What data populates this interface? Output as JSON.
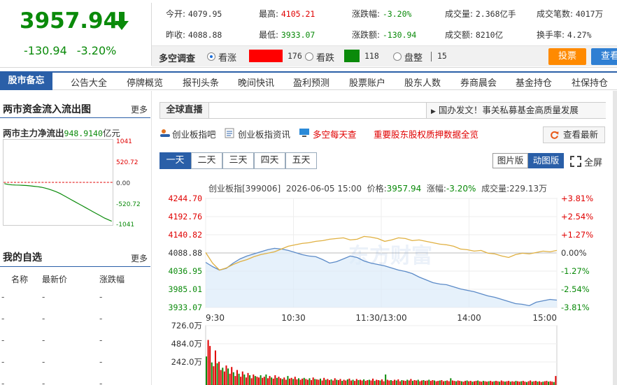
{
  "quote": {
    "price": "3957.94",
    "change": "-130.94",
    "change_pct": "-3.20%",
    "fields": [
      {
        "label": "今开:",
        "value": "4079.95"
      },
      {
        "label": "最高:",
        "value": "4105.21"
      },
      {
        "label": "涨跌幅:",
        "value": "-3.20%"
      },
      {
        "label": "成交量:",
        "value": "2.368亿手"
      },
      {
        "label": "成交笔数:",
        "value": "4017万"
      },
      {
        "label": "昨收:",
        "value": "4088.88"
      },
      {
        "label": "最低:",
        "value": "3933.07"
      },
      {
        "label": "涨跌额:",
        "value": "-130.94"
      },
      {
        "label": "成交额:",
        "value": "8210亿"
      },
      {
        "label": "换手率:",
        "value": "4.27%"
      }
    ]
  },
  "survey": {
    "title": "多空调查",
    "bull_label": "看涨",
    "bull_count": "176",
    "bear_label": "看跌",
    "bear_count": "118",
    "flat_label": "盘整",
    "flat_count": "15",
    "vote_label": "投票",
    "view_label": "查看"
  },
  "nav": {
    "title": "股市备忘",
    "items": [
      "公告大全",
      "停牌概览",
      "报刊头条",
      "晚间快讯",
      "盈利预测",
      "股票账户",
      "股东人数",
      "券商晨会",
      "基金持仓",
      "社保持仓"
    ]
  },
  "flow": {
    "title": "两市资金流入流出图",
    "more": "更多",
    "net_label": "两市主力净流出",
    "net_value": "948.9140",
    "net_unit": "亿元",
    "axis_labels": [
      "1041",
      "520.72",
      "0.00",
      "-520.72",
      "-1041"
    ],
    "chart_data": {
      "type": "line",
      "ylim": [
        -1041,
        1041
      ],
      "values": [
        -30,
        -50,
        -60,
        -65,
        -68,
        -72,
        -78,
        -85,
        -95,
        -105,
        -120,
        -140,
        -165,
        -195,
        -230,
        -270,
        -320,
        -370,
        -420,
        -470,
        -520,
        -570,
        -620,
        -670,
        -720,
        -770,
        -820,
        -870,
        -910,
        -949
      ]
    }
  },
  "watchlist": {
    "title": "我的自选",
    "more": "更多",
    "columns": [
      "名称",
      "最新价",
      "涨跌幅"
    ],
    "rows": [
      [
        "-",
        "-",
        "-"
      ],
      [
        "-",
        "-",
        "-"
      ],
      [
        "-",
        "-",
        "-"
      ],
      [
        "-",
        "-",
        "-"
      ],
      [
        "-",
        "-",
        "-"
      ]
    ]
  },
  "live": {
    "label": "全球直播",
    "news": "国办发文！事关私募基金高质量发展"
  },
  "tools": {
    "link1": "创业板指吧",
    "link2": "创业板指资讯",
    "link3": "多空每天查",
    "link4": "重要股东股权质押数据全览",
    "refresh": "查看最新"
  },
  "tabs": [
    "一天",
    "二天",
    "三天",
    "四天",
    "五天"
  ],
  "view_buttons": {
    "pic": "图片版",
    "anim": "动图版",
    "full": "全屏"
  },
  "chart_info": {
    "name": "创业板指[399006]",
    "datetime": "2026-06-05 15:00",
    "price_label": "价格:",
    "price": "3957.94",
    "chg_label": "涨幅:",
    "chg": "-3.20%",
    "vol_label": "成交量:",
    "vol": "229.13万"
  },
  "watermark": "东方财富",
  "colors": {
    "accent": "#2a5fa8",
    "up": "#e00000",
    "down": "#0a8a0a",
    "orange": "#ff8a00"
  },
  "chart_data": {
    "type": "line",
    "base": 4088.88,
    "ylim": [
      3933.07,
      4244.7
    ],
    "y_ticks_left": [
      "4244.70",
      "4192.76",
      "4140.82",
      "4088.88",
      "4036.95",
      "3985.01",
      "3933.07"
    ],
    "y_ticks_right": [
      "+3.81%",
      "+2.54%",
      "+1.27%",
      "0.00%",
      "-1.27%",
      "-2.54%",
      "-3.81%"
    ],
    "x_ticks": [
      "9:30",
      "10:30",
      "11:30/13:00",
      "14:00",
      "15:00"
    ],
    "series": [
      {
        "values": [
          4062,
          4050,
          4040,
          4045,
          4060,
          4072,
          4080,
          4086,
          4092,
          4098,
          4102,
          4100,
          4096,
          4090,
          4084,
          4080,
          4078,
          4070,
          4060,
          4064,
          4072,
          4080,
          4076,
          4066,
          4060,
          4056,
          4052,
          4046,
          4040,
          4036,
          4030,
          4020,
          4012,
          4004,
          4000,
          3998,
          3992,
          3986,
          3982,
          3978,
          3972,
          3966,
          3962,
          3956,
          3950,
          3944,
          3942,
          3938,
          3948,
          3952,
          3956,
          3954
        ]
      },
      {
        "values": [
          4090,
          4060,
          4040,
          4046,
          4056,
          4064,
          4070,
          4078,
          4084,
          4088,
          4092,
          4100,
          4108,
          4112,
          4116,
          4118,
          4122,
          4124,
          4128,
          4130,
          4132,
          4126,
          4128,
          4136,
          4134,
          4130,
          4122,
          4126,
          4132,
          4130,
          4124,
          4126,
          4122,
          4118,
          4114,
          4112,
          4108,
          4100,
          4098,
          4094,
          4096,
          4088,
          4086,
          4080,
          4076,
          4084,
          4088,
          4086,
          4090,
          4094,
          4092,
          4096
        ]
      }
    ],
    "volume": {
      "ylim": [
        0,
        726
      ],
      "y_ticks": [
        "726.0万",
        "484.0万",
        "242.0万"
      ],
      "values": [
        380,
        600,
        520,
        300,
        250,
        460,
        290,
        310,
        200,
        230,
        180,
        260,
        220,
        150,
        240,
        170,
        120,
        200,
        150,
        110,
        180,
        140,
        100,
        160,
        130,
        90,
        140,
        120,
        110,
        100,
        130,
        95,
        110,
        140,
        90,
        120,
        100,
        85,
        130,
        95,
        110,
        90,
        80,
        100,
        70,
        120,
        85,
        95,
        80,
        110,
        75,
        90,
        70,
        85,
        95,
        80,
        70,
        90,
        65,
        100,
        80,
        75,
        70,
        85,
        60,
        95,
        70,
        80,
        65,
        75,
        60,
        90,
        70,
        65,
        80,
        55,
        70,
        60,
        75,
        85,
        60,
        70,
        55,
        80,
        65,
        70,
        60,
        75,
        55,
        65,
        70,
        60,
        85,
        55,
        70,
        65,
        60,
        75,
        50,
        140,
        70,
        60,
        65,
        55,
        70,
        60,
        75,
        50,
        65,
        60,
        55,
        70,
        60,
        80,
        55,
        65,
        60,
        70,
        50,
        60,
        65,
        55,
        60,
        70,
        55,
        65,
        60,
        50,
        55,
        60,
        65,
        50,
        55,
        60,
        50,
        90,
        60,
        55,
        50,
        60,
        55,
        50,
        45,
        55,
        60,
        50,
        55,
        45,
        50,
        55,
        60,
        50,
        45,
        55,
        50,
        45,
        50,
        55,
        45,
        50,
        55,
        50,
        45,
        60,
        50,
        45,
        50,
        55,
        45,
        50,
        45,
        55,
        50,
        45,
        50,
        55,
        45,
        40,
        50,
        60,
        45,
        50,
        55,
        45,
        50,
        40,
        45,
        50,
        55,
        45,
        50,
        45,
        40,
        120
      ]
    }
  }
}
